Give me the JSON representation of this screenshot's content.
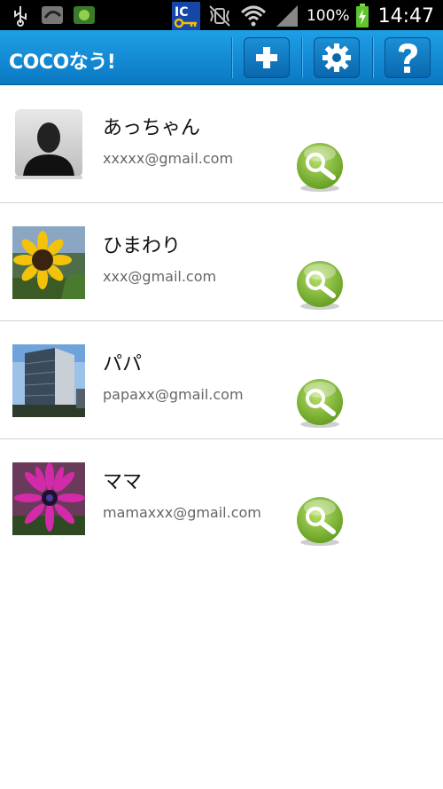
{
  "status_bar": {
    "battery_percent": "100%",
    "time": "14:47",
    "icons": [
      "usb-icon",
      "app-icon",
      "app-icon-2",
      "ic-key-icon",
      "mute-vibrate-icon",
      "wifi-icon",
      "signal-icon",
      "battery-charging-icon"
    ]
  },
  "appbar": {
    "title": "COCOなう!",
    "buttons": [
      "add-icon",
      "settings-gear-icon",
      "help-icon"
    ]
  },
  "contacts": [
    {
      "name": "あっちゃん",
      "email": "xxxxx@gmail.com",
      "avatar": "default-silhouette"
    },
    {
      "name": "ひまわり",
      "email": "xxx@gmail.com",
      "avatar": "sunflower-photo"
    },
    {
      "name": "パパ",
      "email": "papaxx@gmail.com",
      "avatar": "building-photo"
    },
    {
      "name": "ママ",
      "email": "mamaxxx@gmail.com",
      "avatar": "purple-flower-photo"
    }
  ],
  "colors": {
    "appbar": "#0b8ad6",
    "search_green": "#7cb82f"
  }
}
